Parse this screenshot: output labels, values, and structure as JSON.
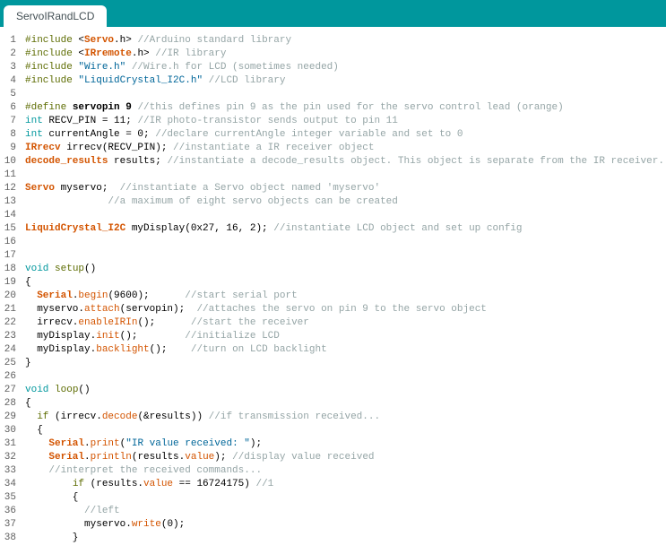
{
  "tab": {
    "title": "ServoIRandLCD"
  },
  "code": [
    [
      {
        "t": "#include ",
        "c": "kw-pp"
      },
      {
        "t": "<",
        "c": "txt"
      },
      {
        "t": "Servo",
        "c": "kw-class bold"
      },
      {
        "t": ".h>",
        "c": "txt"
      },
      {
        "t": " //Arduino standard library",
        "c": "comment"
      }
    ],
    [
      {
        "t": "#include ",
        "c": "kw-pp"
      },
      {
        "t": "<",
        "c": "txt"
      },
      {
        "t": "IRremote",
        "c": "kw-class bold"
      },
      {
        "t": ".h>",
        "c": "txt"
      },
      {
        "t": " //IR library",
        "c": "comment"
      }
    ],
    [
      {
        "t": "#include ",
        "c": "kw-pp"
      },
      {
        "t": "\"Wire.h\"",
        "c": "str"
      },
      {
        "t": " //Wire.h for LCD (sometimes needed)",
        "c": "comment"
      }
    ],
    [
      {
        "t": "#include ",
        "c": "kw-pp"
      },
      {
        "t": "\"LiquidCrystal_I2C.h\"",
        "c": "str"
      },
      {
        "t": " //LCD library",
        "c": "comment"
      }
    ],
    [],
    [
      {
        "t": "#define",
        "c": "kw-pp"
      },
      {
        "t": " servopin 9 ",
        "c": "txt bold"
      },
      {
        "t": "//this defines pin 9 as the pin used for the servo control lead (orange)",
        "c": "comment"
      }
    ],
    [
      {
        "t": "int",
        "c": "kw-type"
      },
      {
        "t": " RECV_PIN = 11; ",
        "c": "txt"
      },
      {
        "t": "//IR photo-transistor sends output to pin 11",
        "c": "comment"
      }
    ],
    [
      {
        "t": "int",
        "c": "kw-type"
      },
      {
        "t": " currentAngle = 0; ",
        "c": "txt"
      },
      {
        "t": "//declare currentAngle integer variable and set to 0",
        "c": "comment"
      }
    ],
    [
      {
        "t": "IRrecv",
        "c": "kw-class bold"
      },
      {
        "t": " irrecv(RECV_PIN); ",
        "c": "txt"
      },
      {
        "t": "//instantiate a IR receiver object",
        "c": "comment"
      }
    ],
    [
      {
        "t": "decode_results",
        "c": "kw-class bold"
      },
      {
        "t": " results; ",
        "c": "txt"
      },
      {
        "t": "//instantiate a decode_results object. This object is separate from the IR receiver.",
        "c": "comment"
      }
    ],
    [],
    [
      {
        "t": "Servo",
        "c": "kw-class bold"
      },
      {
        "t": " myservo;  ",
        "c": "txt"
      },
      {
        "t": "//instantiate a Servo object named 'myservo'",
        "c": "comment"
      }
    ],
    [
      {
        "t": "              ",
        "c": "txt"
      },
      {
        "t": "//a maximum of eight servo objects can be created",
        "c": "comment"
      }
    ],
    [],
    [
      {
        "t": "LiquidCrystal_I2C",
        "c": "kw-class bold"
      },
      {
        "t": " myDisplay(0x27, 16, 2); ",
        "c": "txt"
      },
      {
        "t": "//instantiate LCD object and set up config",
        "c": "comment"
      }
    ],
    [],
    [],
    [
      {
        "t": "void",
        "c": "kw-type"
      },
      {
        "t": " ",
        "c": "txt"
      },
      {
        "t": "setup",
        "c": "kw-pp"
      },
      {
        "t": "()",
        "c": "txt"
      }
    ],
    [
      {
        "t": "{",
        "c": "txt"
      }
    ],
    [
      {
        "t": "  ",
        "c": "txt"
      },
      {
        "t": "Serial",
        "c": "kw-class bold"
      },
      {
        "t": ".",
        "c": "txt"
      },
      {
        "t": "begin",
        "c": "kw-func"
      },
      {
        "t": "(9600);      ",
        "c": "txt"
      },
      {
        "t": "//start serial port",
        "c": "comment"
      }
    ],
    [
      {
        "t": "  myservo.",
        "c": "txt"
      },
      {
        "t": "attach",
        "c": "kw-func"
      },
      {
        "t": "(servopin);  ",
        "c": "txt"
      },
      {
        "t": "//attaches the servo on pin 9 to the servo object",
        "c": "comment"
      }
    ],
    [
      {
        "t": "  irrecv.",
        "c": "txt"
      },
      {
        "t": "enableIRIn",
        "c": "kw-func"
      },
      {
        "t": "();      ",
        "c": "txt"
      },
      {
        "t": "//start the receiver",
        "c": "comment"
      }
    ],
    [
      {
        "t": "  myDisplay.",
        "c": "txt"
      },
      {
        "t": "init",
        "c": "kw-func"
      },
      {
        "t": "();        ",
        "c": "txt"
      },
      {
        "t": "//initialize LCD",
        "c": "comment"
      }
    ],
    [
      {
        "t": "  myDisplay.",
        "c": "txt"
      },
      {
        "t": "backlight",
        "c": "kw-func"
      },
      {
        "t": "();    ",
        "c": "txt"
      },
      {
        "t": "//turn on LCD backlight",
        "c": "comment"
      }
    ],
    [
      {
        "t": "}",
        "c": "txt"
      }
    ],
    [],
    [
      {
        "t": "void",
        "c": "kw-type"
      },
      {
        "t": " ",
        "c": "txt"
      },
      {
        "t": "loop",
        "c": "kw-pp"
      },
      {
        "t": "()",
        "c": "txt"
      }
    ],
    [
      {
        "t": "{",
        "c": "txt"
      }
    ],
    [
      {
        "t": "  ",
        "c": "txt"
      },
      {
        "t": "if",
        "c": "kw-pp"
      },
      {
        "t": " (irrecv.",
        "c": "txt"
      },
      {
        "t": "decode",
        "c": "kw-func"
      },
      {
        "t": "(&results)) ",
        "c": "txt"
      },
      {
        "t": "//if transmission received...",
        "c": "comment"
      }
    ],
    [
      {
        "t": "  {",
        "c": "txt"
      }
    ],
    [
      {
        "t": "    ",
        "c": "txt"
      },
      {
        "t": "Serial",
        "c": "kw-class bold"
      },
      {
        "t": ".",
        "c": "txt"
      },
      {
        "t": "print",
        "c": "kw-func"
      },
      {
        "t": "(",
        "c": "txt"
      },
      {
        "t": "\"IR value received: \"",
        "c": "str"
      },
      {
        "t": ");",
        "c": "txt"
      }
    ],
    [
      {
        "t": "    ",
        "c": "txt"
      },
      {
        "t": "Serial",
        "c": "kw-class bold"
      },
      {
        "t": ".",
        "c": "txt"
      },
      {
        "t": "println",
        "c": "kw-func"
      },
      {
        "t": "(results.",
        "c": "txt"
      },
      {
        "t": "value",
        "c": "kw-func"
      },
      {
        "t": "); ",
        "c": "txt"
      },
      {
        "t": "//display value received",
        "c": "comment"
      }
    ],
    [
      {
        "t": "    ",
        "c": "txt"
      },
      {
        "t": "//interpret the received commands...",
        "c": "comment"
      }
    ],
    [
      {
        "t": "        ",
        "c": "txt"
      },
      {
        "t": "if",
        "c": "kw-pp"
      },
      {
        "t": " (results.",
        "c": "txt"
      },
      {
        "t": "value",
        "c": "kw-func"
      },
      {
        "t": " == 16724175) ",
        "c": "txt"
      },
      {
        "t": "//1",
        "c": "comment"
      }
    ],
    [
      {
        "t": "        {",
        "c": "txt"
      }
    ],
    [
      {
        "t": "          ",
        "c": "txt"
      },
      {
        "t": "//left",
        "c": "comment"
      }
    ],
    [
      {
        "t": "          myservo.",
        "c": "txt"
      },
      {
        "t": "write",
        "c": "kw-func"
      },
      {
        "t": "(0);",
        "c": "txt"
      }
    ],
    [
      {
        "t": "        }",
        "c": "txt"
      }
    ]
  ]
}
